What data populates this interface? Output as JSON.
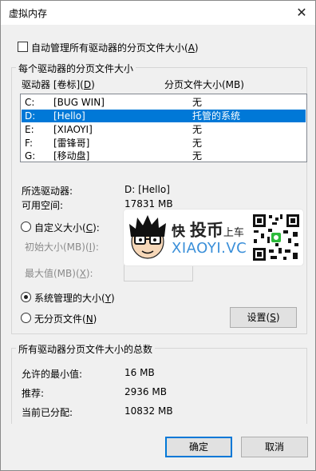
{
  "window": {
    "title": "虚拟内存",
    "close_glyph": "✕"
  },
  "auto_manage": {
    "label": "自动管理所有驱动器的分页文件大小",
    "accel_open": "(",
    "accel_key": "A",
    "accel_close": ")",
    "checked": false
  },
  "drives_group": {
    "title": "每个驱动器的分页文件大小",
    "header_drive_prefix": "驱动器 [卷标](",
    "header_drive_key": "D",
    "header_drive_suffix": ")",
    "header_size": "分页文件大小(MB)",
    "rows": [
      {
        "drive": "C:",
        "label": "[BUG WIN]",
        "size": "无",
        "selected": false
      },
      {
        "drive": "D:",
        "label": "[Hello]",
        "size": "托管的系统",
        "selected": true
      },
      {
        "drive": "E:",
        "label": "[XIAOYI]",
        "size": "无",
        "selected": false
      },
      {
        "drive": "F:",
        "label": "[雷锋哥]",
        "size": "无",
        "selected": false
      },
      {
        "drive": "G:",
        "label": "[移动盘]",
        "size": "无",
        "selected": false
      }
    ],
    "selected_drive_label": "所选驱动器:",
    "selected_drive_value": "D:  [Hello]",
    "free_space_label": "可用空间:",
    "free_space_value": "17831 MB",
    "custom_size": {
      "label": "自定义大小(",
      "key": "C",
      "suffix": "):",
      "selected": false
    },
    "initial_size": {
      "label": "初始大小(MB)(",
      "key": "I",
      "suffix": "):"
    },
    "max_size": {
      "label": "最大值(MB)(",
      "key": "X",
      "suffix": "):"
    },
    "system_managed": {
      "label": "系统管理的大小(",
      "key": "Y",
      "suffix": ")",
      "selected": true
    },
    "no_paging": {
      "label": "无分页文件(",
      "key": "N",
      "suffix": ")",
      "selected": false
    },
    "set_button": {
      "label": "设置(",
      "key": "S",
      "suffix": ")"
    }
  },
  "totals_group": {
    "title": "所有驱动器分页文件大小的总数",
    "min_label": "允许的最小值:",
    "min_value": "16 MB",
    "recommended_label": "推荐:",
    "recommended_value": "2936 MB",
    "current_label": "当前已分配:",
    "current_value": "10832 MB"
  },
  "buttons": {
    "ok": "确定",
    "cancel": "取消"
  },
  "watermark": {
    "cn_1": "快",
    "cn_2": "投币",
    "cn_3": "上车",
    "en": "XIAOYI.VC",
    "qr_label": "QR code"
  },
  "colors": {
    "selection": "#0078d7",
    "watermark_blue": "#3a8fd9"
  }
}
